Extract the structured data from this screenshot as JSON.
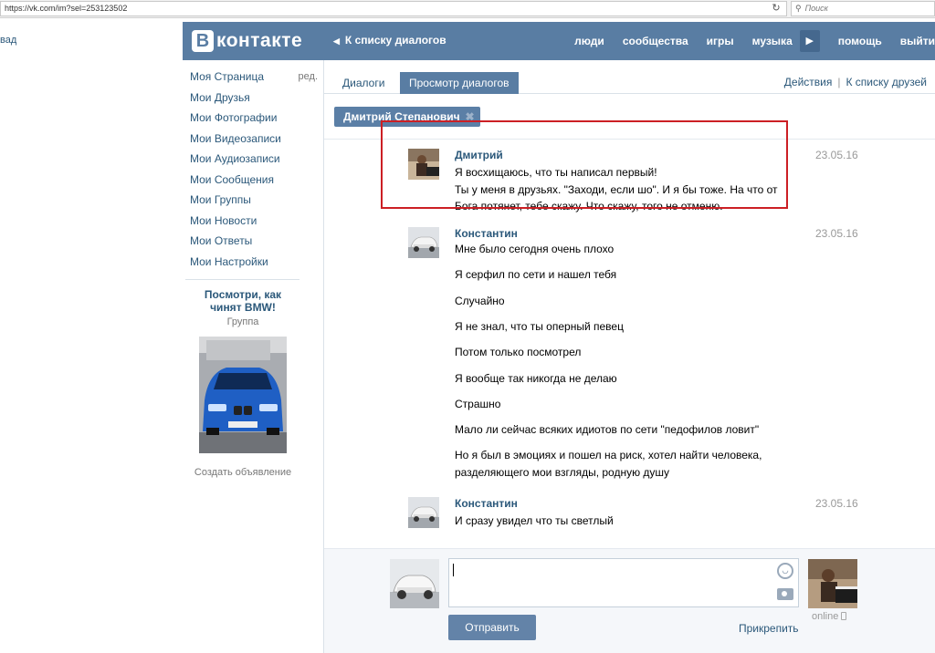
{
  "browser": {
    "url": "https://vk.com/im?sel=253123502",
    "search_placeholder": "Поиск"
  },
  "left_stub": "вад",
  "header": {
    "logo_letter": "В",
    "logo_text": "контакте",
    "back_link": "К списку диалогов",
    "nav": [
      "люди",
      "сообщества",
      "игры",
      "музыка",
      "помощь",
      "выйти"
    ]
  },
  "sidebar": {
    "items": [
      {
        "label": "Моя Страница",
        "extra": "ред."
      },
      {
        "label": "Мои Друзья"
      },
      {
        "label": "Мои Фотографии"
      },
      {
        "label": "Мои Видеозаписи"
      },
      {
        "label": "Мои Аудиозаписи"
      },
      {
        "label": "Мои Сообщения"
      },
      {
        "label": "Мои Группы"
      },
      {
        "label": "Мои Новости"
      },
      {
        "label": "Мои Ответы"
      },
      {
        "label": "Мои Настройки"
      }
    ],
    "promo": {
      "title": "Посмотри, как чинят BMW!",
      "subtitle": "Группа",
      "create_ad": "Создать объявление"
    }
  },
  "tabs": {
    "dialogs": "Диалоги",
    "view": "Просмотр диалогов",
    "actions": "Действия",
    "friends": "К списку друзей"
  },
  "chip": {
    "name": "Дмитрий Степанович",
    "close": "✖"
  },
  "messages": [
    {
      "author": "Дмитрий",
      "date": "23.05.16",
      "lines": [
        "Я восхищаюсь, что ты написал первый!",
        "Ты у меня в друзьях. \"Заходи, если шо\". И я бы тоже. На что от",
        "Бога потянет, тебе скажу. Что скажу, того не отменю."
      ]
    },
    {
      "author": "Константин",
      "date": "23.05.16",
      "lines": [
        "Мне было сегодня очень плохо",
        "Я серфил по сети и нашел тебя",
        "Случайно",
        "Я не знал, что ты оперный певец",
        "Потом только посмотрел",
        "Я вообще так никогда не делаю",
        "Страшно",
        "Мало ли сейчас всяких идиотов по сети \"педофилов ловит\"",
        "Но я был в эмоциях и пошел на риск, хотел найти человека,",
        "разделяющего мои взгляды, родную душу"
      ]
    },
    {
      "author": "Константин",
      "date": "23.05.16",
      "lines": [
        "И сразу увидел что ты светлый"
      ]
    }
  ],
  "composer": {
    "send": "Отправить",
    "attach": "Прикрепить",
    "status": "online"
  },
  "colors": {
    "header": "#597da3",
    "link": "#2b587a",
    "highlight": "#cc1f24"
  }
}
